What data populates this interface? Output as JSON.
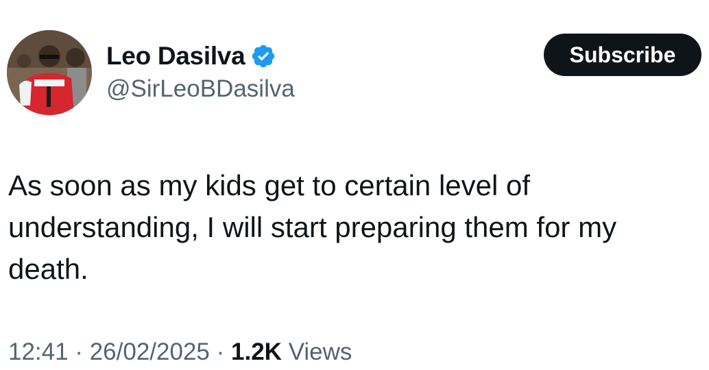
{
  "author": {
    "display_name": "Leo Dasilva",
    "handle": "@SirLeoBDasilva",
    "verified": true,
    "verified_icon": "verified-badge-icon",
    "verified_color": "#1d9bf0"
  },
  "subscribe": {
    "label": "Subscribe"
  },
  "tweet": {
    "text": "As soon as my kids get to certain level of understanding, I will start preparing them for my death."
  },
  "meta": {
    "time": "12:41",
    "separator": "·",
    "date": "26/02/2025",
    "views_count": "1.2K",
    "views_label": "Views"
  },
  "colors": {
    "text_primary": "#0f1419",
    "text_secondary": "#536471",
    "button_bg": "#0f1419",
    "button_text": "#ffffff"
  }
}
